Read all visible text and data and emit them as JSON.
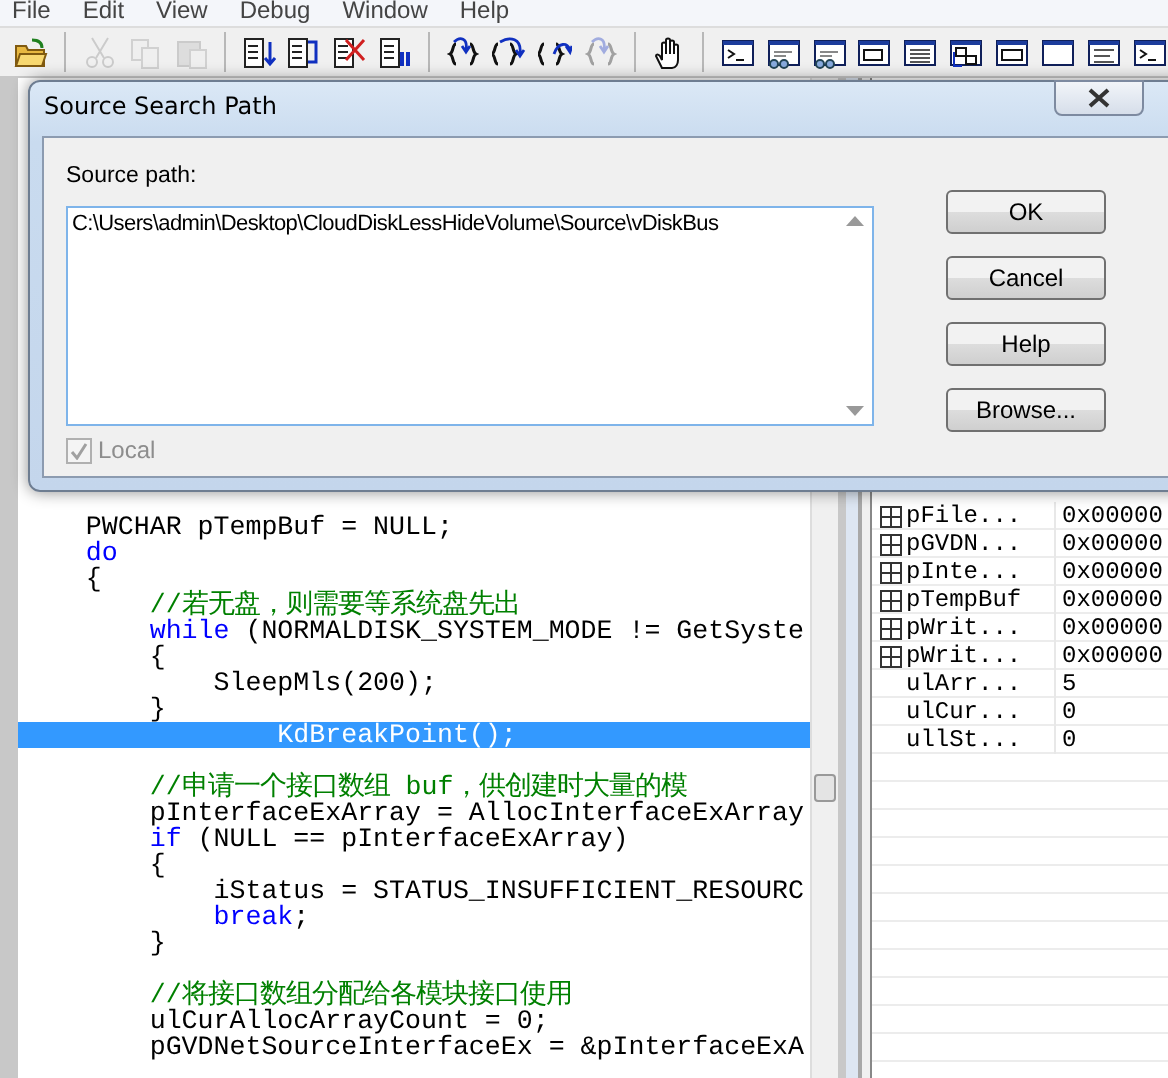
{
  "menu": [
    "File",
    "Edit",
    "View",
    "Debug",
    "Window",
    "Help"
  ],
  "toolbar": [
    {
      "kind": "folder",
      "disabled": false
    },
    {
      "kind": "separator"
    },
    {
      "kind": "scissors",
      "disabled": true
    },
    {
      "kind": "pages",
      "disabled": true
    },
    {
      "kind": "clipboard",
      "disabled": true
    },
    {
      "kind": "separator"
    },
    {
      "kind": "list_down",
      "disabled": false
    },
    {
      "kind": "list_loop",
      "disabled": false
    },
    {
      "kind": "list_cross",
      "disabled": false
    },
    {
      "kind": "list_bars",
      "disabled": false
    },
    {
      "kind": "separator"
    },
    {
      "kind": "braces_in",
      "disabled": false
    },
    {
      "kind": "braces_over",
      "disabled": false
    },
    {
      "kind": "braces_out",
      "disabled": false
    },
    {
      "kind": "braces_in",
      "disabled": true
    },
    {
      "kind": "separator"
    },
    {
      "kind": "hand",
      "disabled": false
    },
    {
      "kind": "separator"
    },
    {
      "kind": "window_prompt",
      "disabled": false
    },
    {
      "kind": "window_glasses",
      "disabled": false
    },
    {
      "kind": "window_glasses",
      "disabled": false
    },
    {
      "kind": "window_hex",
      "disabled": false
    },
    {
      "kind": "window_list",
      "disabled": false
    },
    {
      "kind": "window_tree",
      "disabled": false
    },
    {
      "kind": "window_dec",
      "disabled": false
    },
    {
      "kind": "window_blank",
      "disabled": false
    },
    {
      "kind": "window_lines",
      "disabled": false
    },
    {
      "kind": "window_prompt",
      "disabled": false
    }
  ],
  "source": {
    "lines": [
      {
        "selected": false,
        "tokens": [
          {
            "kind": "plain",
            "text": "    PWCHAR pTempBuf = NULL;"
          }
        ]
      },
      {
        "selected": false,
        "tokens": [
          {
            "kind": "keyword",
            "text": "    do"
          }
        ]
      },
      {
        "selected": false,
        "tokens": [
          {
            "kind": "plain",
            "text": "    {"
          }
        ]
      },
      {
        "selected": false,
        "tokens": [
          {
            "kind": "comment",
            "text": "        //若无盘，则需要等系统盘先出"
          }
        ]
      },
      {
        "selected": false,
        "tokens": [
          {
            "kind": "keyword",
            "text": "        while"
          },
          {
            "kind": "plain",
            "text": " (NORMALDISK_SYSTEM_MODE != GetSyste"
          }
        ]
      },
      {
        "selected": false,
        "tokens": [
          {
            "kind": "plain",
            "text": "        {"
          }
        ]
      },
      {
        "selected": false,
        "tokens": [
          {
            "kind": "plain",
            "text": "            SleepMls(200);"
          }
        ]
      },
      {
        "selected": false,
        "tokens": [
          {
            "kind": "plain",
            "text": "        }"
          }
        ]
      },
      {
        "selected": true,
        "tokens": [
          {
            "kind": "plain",
            "text": "                KdBreakPoint();"
          }
        ]
      },
      {
        "selected": false
      },
      {
        "selected": false,
        "tokens": [
          {
            "kind": "comment",
            "text": "        //申请一个接口数组 buf，供创建时大量的模"
          }
        ]
      },
      {
        "selected": false,
        "tokens": [
          {
            "kind": "plain",
            "text": "        pInterfaceExArray = AllocInterfaceExArray"
          }
        ]
      },
      {
        "selected": false,
        "tokens": [
          {
            "kind": "keyword",
            "text": "        if"
          },
          {
            "kind": "plain",
            "text": " (NULL == pInterfaceExArray)"
          }
        ]
      },
      {
        "selected": false,
        "tokens": [
          {
            "kind": "plain",
            "text": "        {"
          }
        ]
      },
      {
        "selected": false,
        "tokens": [
          {
            "kind": "plain",
            "text": "            iStatus = STATUS_INSUFFICIENT_RESOURC"
          }
        ]
      },
      {
        "selected": false,
        "tokens": [
          {
            "kind": "keyword",
            "text": "            break"
          },
          {
            "kind": "plain",
            "text": ";"
          }
        ]
      },
      {
        "selected": false,
        "tokens": [
          {
            "kind": "plain",
            "text": "        }"
          }
        ]
      },
      {
        "selected": false
      },
      {
        "selected": false,
        "tokens": [
          {
            "kind": "comment",
            "text": "        //将接口数组分配给各模块接口使用"
          }
        ]
      },
      {
        "selected": false,
        "tokens": [
          {
            "kind": "plain",
            "text": "        ulCurAllocArrayCount = 0;"
          }
        ]
      },
      {
        "selected": false,
        "tokens": [
          {
            "kind": "plain",
            "text": "        pGVDNetSourceInterfaceEx = &pInterfaceExA"
          }
        ]
      }
    ]
  },
  "locals": {
    "rows": [
      {
        "name": "pFile...",
        "value": "0x00000",
        "expandable": true
      },
      {
        "name": "pGVDN...",
        "value": "0x00000",
        "expandable": true
      },
      {
        "name": "pInte...",
        "value": "0x00000",
        "expandable": true
      },
      {
        "name": "pTempBuf",
        "value": "0x00000",
        "expandable": true
      },
      {
        "name": "pWrit...",
        "value": "0x00000",
        "expandable": true
      },
      {
        "name": "pWrit...",
        "value": "0x00000",
        "expandable": true
      },
      {
        "name": "ulArr...",
        "value": "5",
        "expandable": false
      },
      {
        "name": "ulCur...",
        "value": "0",
        "expandable": false
      },
      {
        "name": "ullSt...",
        "value": "0",
        "expandable": false
      }
    ]
  },
  "dialog": {
    "title": "Source Search Path",
    "field_label": "Source path:",
    "path": "C:\\Users\\admin\\Desktop\\CloudDiskLessHideVolume\\Source\\vDiskBus",
    "checkbox": {
      "label": "Local",
      "checked": true,
      "disabled": true
    },
    "buttons": [
      "OK",
      "Cancel",
      "Help",
      "Browse..."
    ]
  }
}
